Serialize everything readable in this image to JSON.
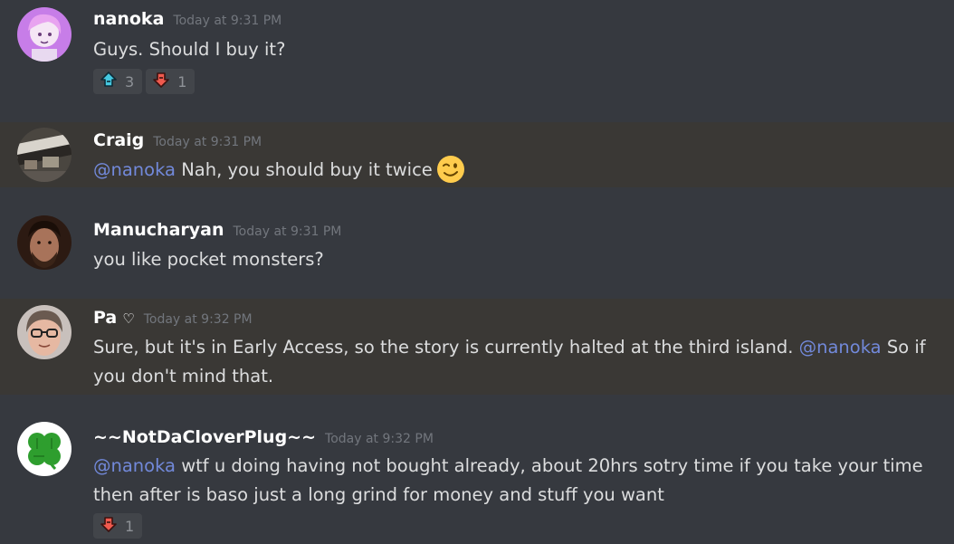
{
  "messages": [
    {
      "author": "nanoka",
      "timestamp": "Today at 9:31 PM",
      "text": "Guys. Should I buy it?",
      "reactions": [
        {
          "icon": "upvote-arrow-icon",
          "count": "3"
        },
        {
          "icon": "downvote-arrow-icon",
          "count": "1"
        }
      ]
    },
    {
      "author": "Craig",
      "timestamp": "Today at 9:31 PM",
      "mention": "@nanoka",
      "text": "Nah, you should buy it twice",
      "emoji": "winking-face-emoji"
    },
    {
      "author": "Manucharyan",
      "timestamp": "Today at 9:31 PM",
      "text": "you like pocket monsters?"
    },
    {
      "author": "Pa",
      "author_suffix": "♡",
      "timestamp": "Today at 9:32 PM",
      "text_before": "Sure, but it's in Early Access, so the story is currently halted at the third island.",
      "mention": "@nanoka",
      "text_after": "So if you don't mind that."
    },
    {
      "author": "~~NotDaCloverPlug~~",
      "timestamp": "Today at 9:32 PM",
      "mention": "@nanoka",
      "text": "wtf u doing having not bought already, about 20hrs sotry time if you take your time then after is baso just a long grind for money and stuff you want",
      "reactions": [
        {
          "icon": "downvote-arrow-icon",
          "count": "1"
        }
      ]
    }
  ],
  "colors": {
    "background": "#36393f",
    "highlight": "#3a3835",
    "mention": "#7289da",
    "username": "#ffffff",
    "timestamp": "#72767d",
    "reaction_bg": "#42454a"
  }
}
